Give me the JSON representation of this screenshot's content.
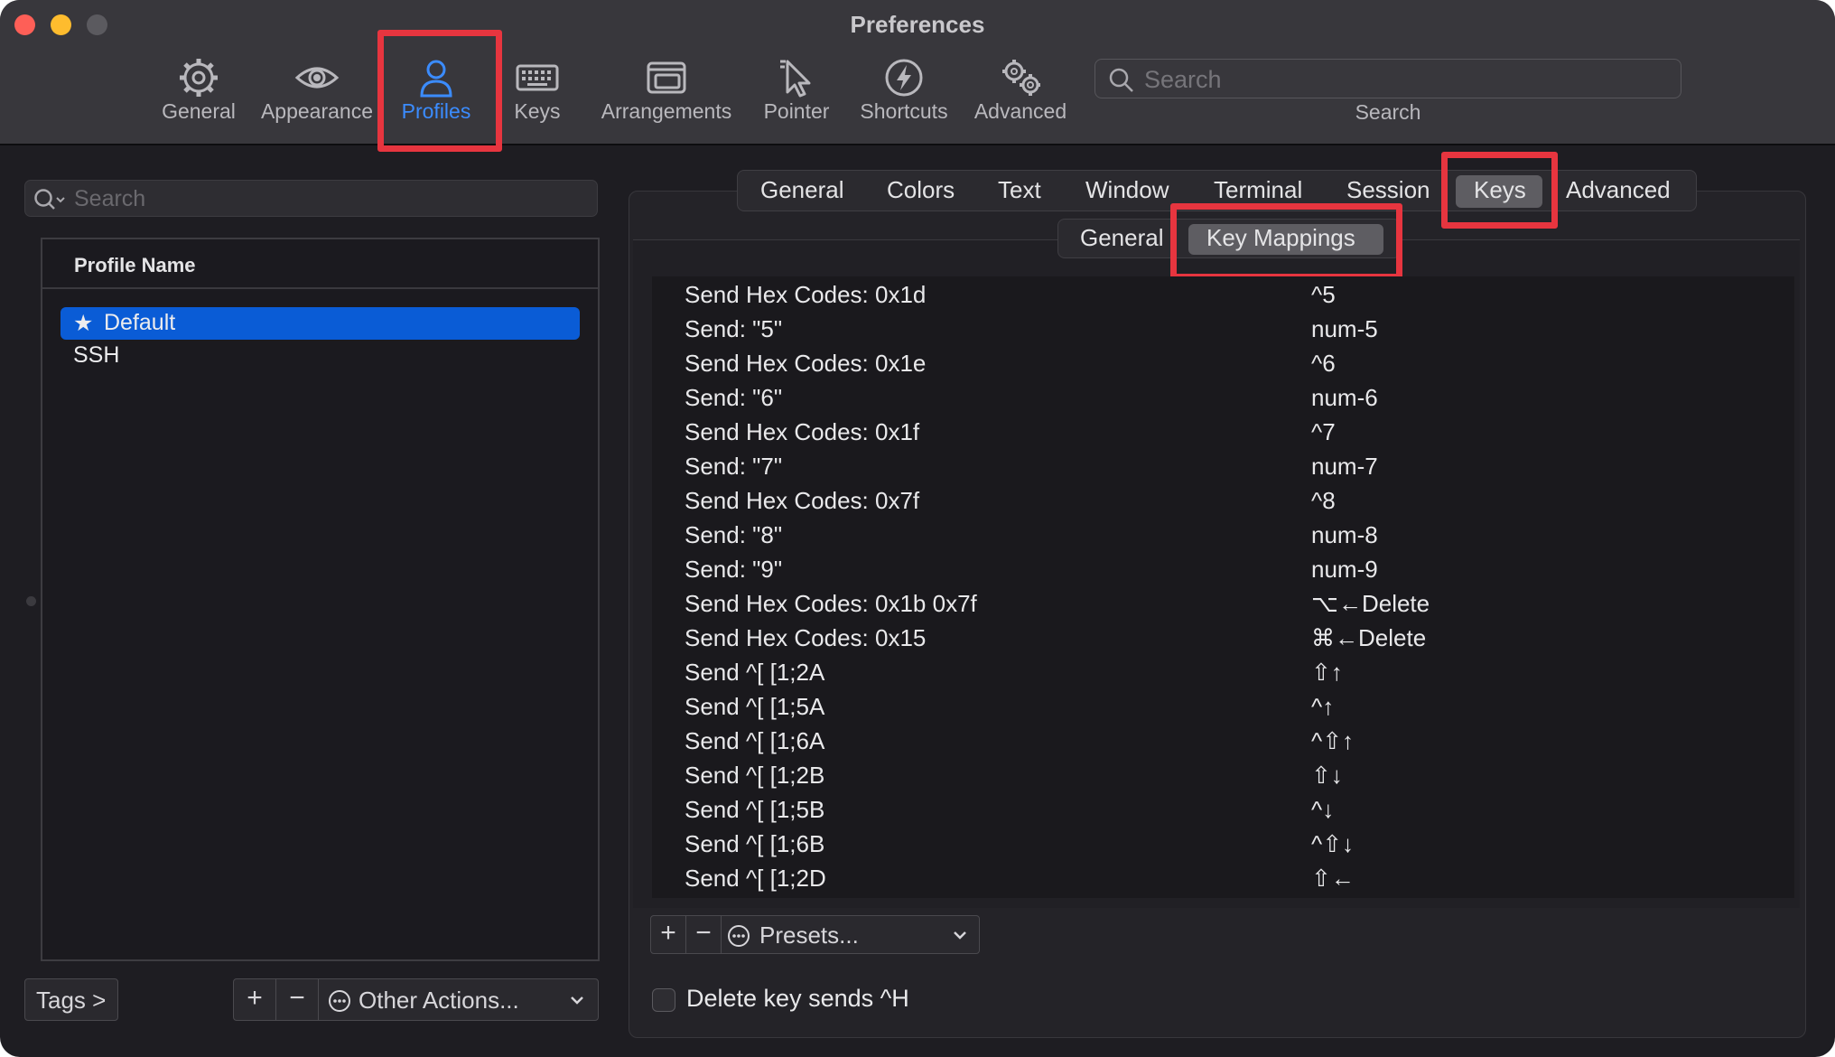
{
  "window": {
    "title": "Preferences"
  },
  "toolbar": {
    "items": [
      {
        "label": "General",
        "icon": "gear-icon"
      },
      {
        "label": "Appearance",
        "icon": "eye-icon"
      },
      {
        "label": "Profiles",
        "icon": "person-icon",
        "active": true
      },
      {
        "label": "Keys",
        "icon": "keyboard-icon"
      },
      {
        "label": "Arrangements",
        "icon": "window-stack-icon"
      },
      {
        "label": "Pointer",
        "icon": "cursor-icon"
      },
      {
        "label": "Shortcuts",
        "icon": "lightning-icon"
      },
      {
        "label": "Advanced",
        "icon": "gears-icon"
      }
    ],
    "search": {
      "placeholder": "Search",
      "label": "Search"
    }
  },
  "sidebar": {
    "search_placeholder": "Search",
    "column_header": "Profile Name",
    "profiles": [
      {
        "name": "Default",
        "default": true,
        "selected": true
      },
      {
        "name": "SSH"
      }
    ],
    "tags_label": "Tags >",
    "add_label": "+",
    "remove_label": "−",
    "other_actions_label": "Other Actions..."
  },
  "profile_tabs": {
    "tabs": [
      "General",
      "Colors",
      "Text",
      "Window",
      "Terminal",
      "Session",
      "Keys",
      "Advanced"
    ],
    "selected": "Keys"
  },
  "keys_subtabs": {
    "tabs": [
      "General",
      "Key Mappings"
    ],
    "selected": "Key Mappings"
  },
  "key_mappings": [
    {
      "action": "Send Hex Codes: 0x1d",
      "keys": "^5"
    },
    {
      "action": "Send: \"5\"",
      "keys": "num-5"
    },
    {
      "action": "Send Hex Codes: 0x1e",
      "keys": "^6"
    },
    {
      "action": "Send: \"6\"",
      "keys": "num-6"
    },
    {
      "action": "Send Hex Codes: 0x1f",
      "keys": "^7"
    },
    {
      "action": "Send: \"7\"",
      "keys": "num-7"
    },
    {
      "action": "Send Hex Codes: 0x7f",
      "keys": "^8"
    },
    {
      "action": "Send: \"8\"",
      "keys": "num-8"
    },
    {
      "action": "Send: \"9\"",
      "keys": "num-9"
    },
    {
      "action": "Send Hex Codes: 0x1b 0x7f",
      "keys": "⌥←Delete"
    },
    {
      "action": "Send Hex Codes: 0x15",
      "keys": "⌘←Delete"
    },
    {
      "action": "Send ^[ [1;2A",
      "keys": "⇧↑"
    },
    {
      "action": "Send ^[ [1;5A",
      "keys": "^↑"
    },
    {
      "action": "Send ^[ [1;6A",
      "keys": "^⇧↑"
    },
    {
      "action": "Send ^[ [1;2B",
      "keys": "⇧↓"
    },
    {
      "action": "Send ^[ [1;5B",
      "keys": "^↓"
    },
    {
      "action": "Send ^[ [1;6B",
      "keys": "^⇧↓"
    },
    {
      "action": "Send ^[ [1;2D",
      "keys": "⇧←"
    }
  ],
  "mapping_controls": {
    "add_label": "+",
    "remove_label": "−",
    "presets_label": "Presets..."
  },
  "delete_key_option": {
    "label": "Delete key sends ^H",
    "checked": false
  },
  "colors": {
    "highlight": "#e7353f",
    "accent": "#3b8cff",
    "selection": "#0a5cd6"
  }
}
